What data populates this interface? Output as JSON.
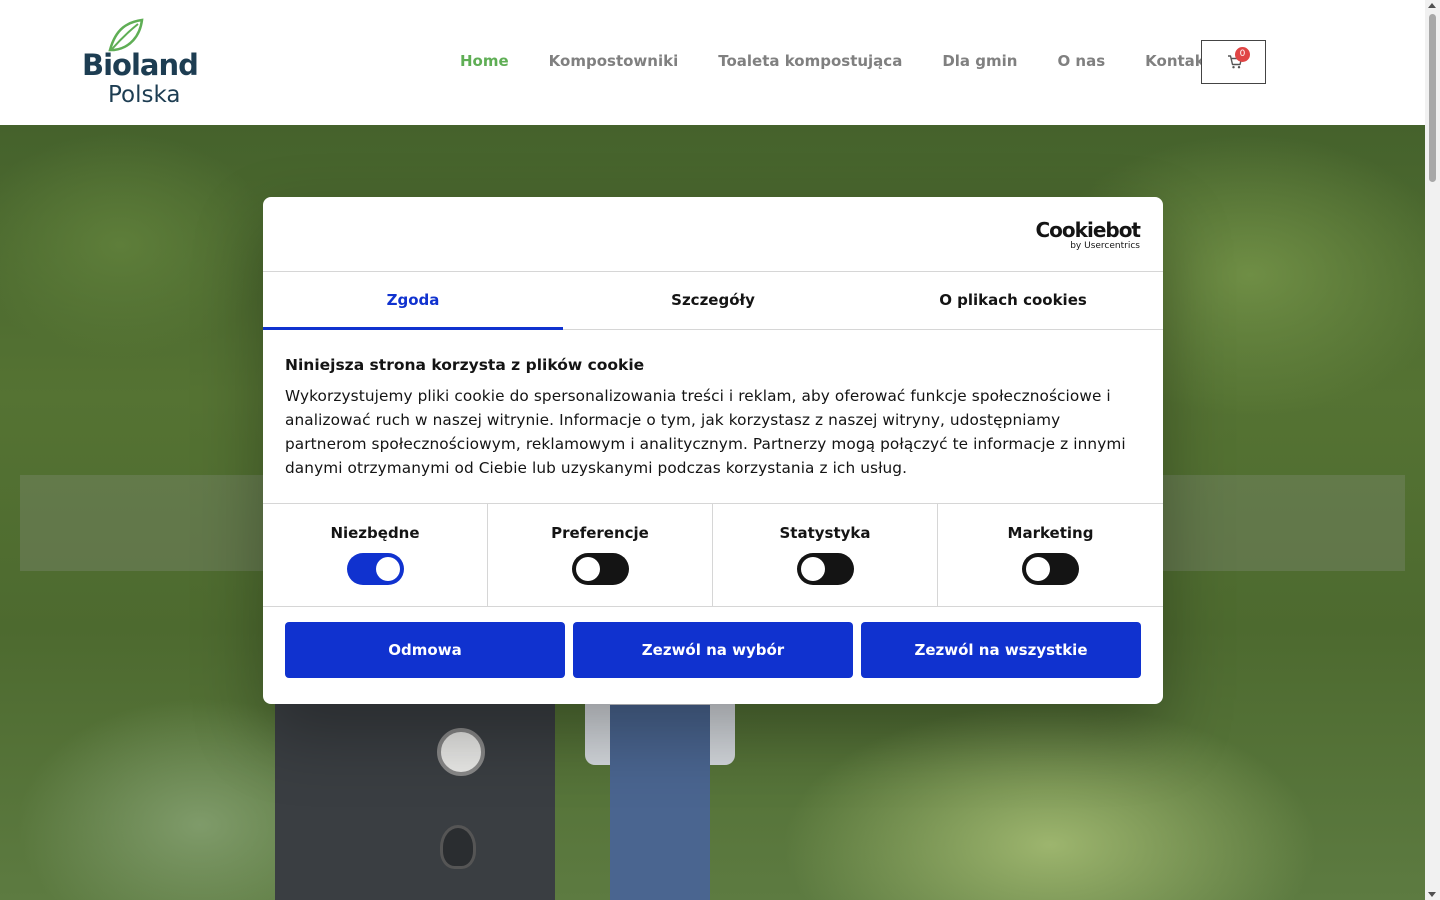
{
  "header": {
    "logo": {
      "brand": "Bioland",
      "sub": "Polska",
      "icon": "leaf-icon"
    },
    "nav": [
      {
        "label": "Home",
        "active": true
      },
      {
        "label": "Kompostowniki",
        "active": false
      },
      {
        "label": "Toaleta kompostująca",
        "active": false
      },
      {
        "label": "Dla gmin",
        "active": false
      },
      {
        "label": "O nas",
        "active": false
      },
      {
        "label": "Kontakt",
        "active": false
      }
    ],
    "cart": {
      "icon": "cart-icon",
      "count": "0"
    }
  },
  "cookie_dialog": {
    "provider": {
      "name": "Cookiebot",
      "by": "by Usercentrics"
    },
    "tabs": [
      {
        "label": "Zgoda",
        "active": true
      },
      {
        "label": "Szczegóły",
        "active": false
      },
      {
        "label": "O plikach cookies",
        "active": false
      }
    ],
    "title": "Niniejsza strona korzysta z plików cookie",
    "body": "Wykorzystujemy pliki cookie do spersonalizowania treści i reklam, aby oferować funkcje społecznościowe i analizować ruch w naszej witrynie. Informacje o tym, jak korzystasz z naszej witryny, udostępniamy partnerom społecznościowym, reklamowym i analitycznym. Partnerzy mogą połączyć te informacje z innymi danymi otrzymanymi od Ciebie lub uzyskanymi podczas korzystania z ich usług.",
    "categories": [
      {
        "label": "Niezbędne",
        "enabled": true
      },
      {
        "label": "Preferencje",
        "enabled": false
      },
      {
        "label": "Statystyka",
        "enabled": false
      },
      {
        "label": "Marketing",
        "enabled": false
      }
    ],
    "buttons": {
      "deny": "Odmowa",
      "allow_selection": "Zezwól na wybór",
      "allow_all": "Zezwól na wszystkie"
    }
  },
  "colors": {
    "accent": "#1032cf",
    "nav_active": "#5fae55",
    "brand_dark": "#1d3d52",
    "cart_badge": "#e04545"
  }
}
